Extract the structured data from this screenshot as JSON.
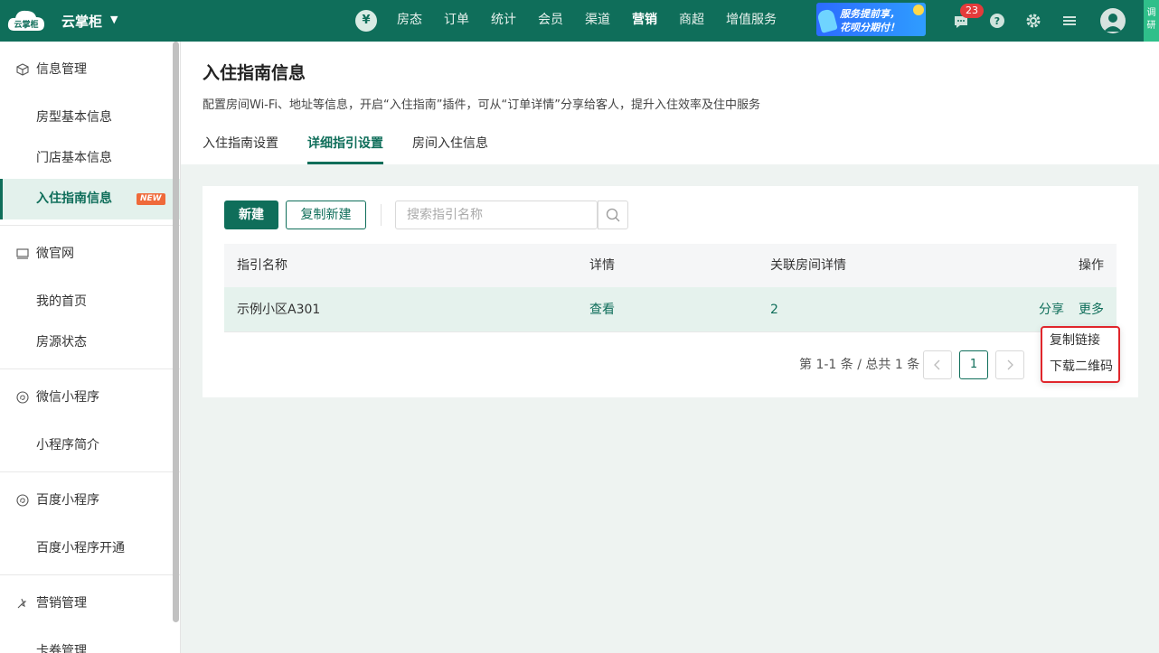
{
  "topbar": {
    "logo_text": "云掌柜",
    "app_name": "云掌柜",
    "yen_symbol": "¥",
    "nav": [
      "房态",
      "订单",
      "统计",
      "会员",
      "渠道",
      "营销",
      "商超",
      "增值服务"
    ],
    "active_nav_index": 5,
    "promo": {
      "line1": "服务提前享，",
      "line2": "花呗分期付！"
    },
    "message_count": "23",
    "side_tab": "调研",
    "colors": {
      "primary": "#0f6e5a",
      "badge": "#e43b3b"
    }
  },
  "sidebar": {
    "groups": [
      {
        "title": "信息管理",
        "icon": "cube-icon",
        "items": [
          "房型基本信息",
          "门店基本信息",
          "入住指南信息"
        ]
      },
      {
        "title": "微官网",
        "icon": "monitor-icon",
        "items": [
          "我的首页",
          "房源状态"
        ]
      },
      {
        "title": "微信小程序",
        "icon": "mini-program-icon",
        "items": [
          "小程序简介"
        ]
      },
      {
        "title": "百度小程序",
        "icon": "mini-program-icon",
        "items": [
          "百度小程序开通"
        ]
      },
      {
        "title": "营销管理",
        "icon": "marketing-icon",
        "items": [
          "卡券管理"
        ]
      }
    ],
    "new_badge": "NEW"
  },
  "header": {
    "title": "入住指南信息",
    "description": "配置房间Wi-Fi、地址等信息，开启“入住指南”插件，可从“订单详情”分享给客人，提升入住效率及住中服务",
    "tabs": [
      "入住指南设置",
      "详细指引设置",
      "房间入住信息"
    ],
    "active_tab_index": 1
  },
  "toolbar": {
    "new_label": "新建",
    "copy_new_label": "复制新建",
    "search_placeholder": "搜索指引名称"
  },
  "table": {
    "columns": [
      "指引名称",
      "详情",
      "关联房间详情",
      "操作"
    ],
    "rows": [
      {
        "name": "示例小区A301",
        "detail": "查看",
        "rooms": "2",
        "share": "分享",
        "more": "更多"
      }
    ]
  },
  "pagination": {
    "info": "第 1-1 条 / 总共 1 条",
    "current_page": "1"
  },
  "dropdown": {
    "items": [
      "复制链接",
      "下载二维码"
    ]
  }
}
